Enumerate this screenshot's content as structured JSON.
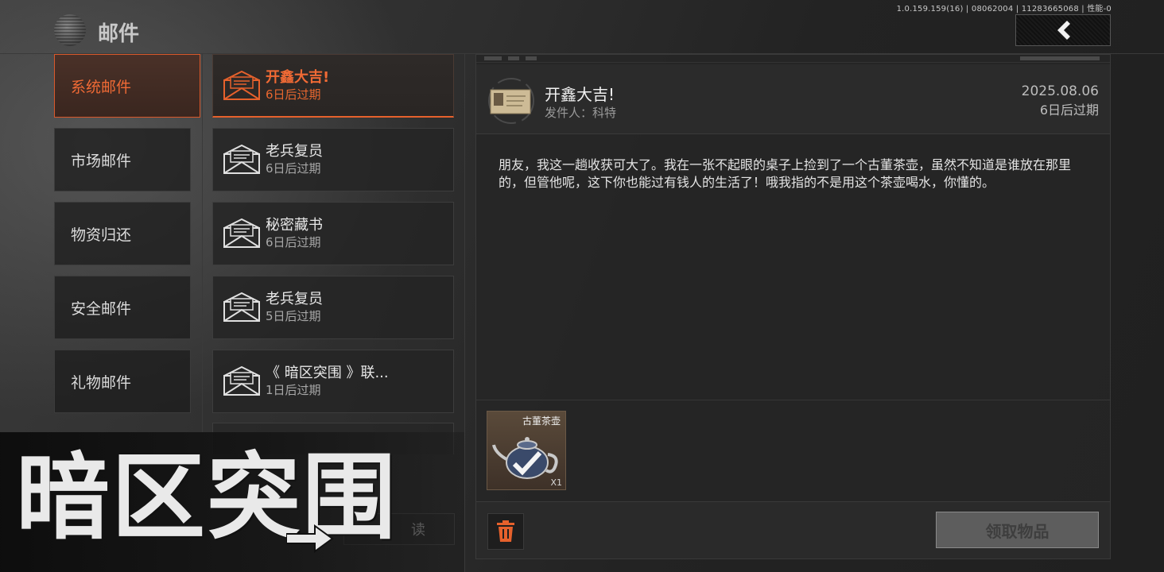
{
  "header": {
    "title": "邮件",
    "version": "1.0.159.159(16) | 08062004 | 11283665068 | 性能-0"
  },
  "categories": [
    {
      "label": "系统邮件",
      "active": true
    },
    {
      "label": "市场邮件",
      "active": false
    },
    {
      "label": "物资归还",
      "active": false
    },
    {
      "label": "安全邮件",
      "active": false
    },
    {
      "label": "礼物邮件",
      "active": false
    }
  ],
  "mails": [
    {
      "title": "开鑫大吉!",
      "expiry": "6日后过期",
      "active": true
    },
    {
      "title": "老兵复员",
      "expiry": "6日后过期",
      "active": false
    },
    {
      "title": "秘密藏书",
      "expiry": "6日后过期",
      "active": false
    },
    {
      "title": "老兵复员",
      "expiry": "5日后过期",
      "active": false
    },
    {
      "title": "《 暗区突围 》联...",
      "expiry": "1日后过期",
      "active": false
    }
  ],
  "read_all_label": "读",
  "detail": {
    "title": "开鑫大吉!",
    "sender": "发件人：科特",
    "date": "2025.08.06",
    "expiry": "6日后过期",
    "body": "朋友，我这一趟收获可大了。我在一张不起眼的桌子上捡到了一个古董茶壶，虽然不知道是谁放在那里的，但管他呢，这下你也能过有钱人的生活了！哦我指的不是用这个茶壶喝水，你懂的。",
    "attachment": {
      "name": "古董茶壶",
      "quantity": "X1"
    },
    "claim_label": "领取物品"
  },
  "logo_text": "暗区突围",
  "colors": {
    "accent": "#e6612c",
    "background": "#232323"
  }
}
